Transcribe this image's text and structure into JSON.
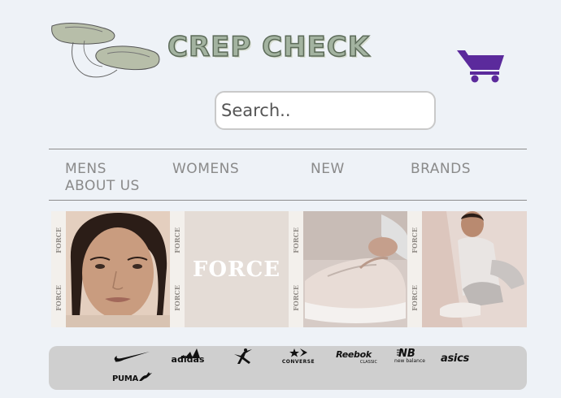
{
  "header": {
    "title": "CREP CHECK",
    "logo_icon": "sneakers-sketch-icon",
    "cart_icon": "shopping-cart-icon",
    "accent_color": "#5b2a9c"
  },
  "search": {
    "placeholder": "Search.."
  },
  "nav": {
    "items": [
      {
        "label": "MENS"
      },
      {
        "label": "WOMENS"
      },
      {
        "label": "NEW"
      },
      {
        "label": "BRANDS"
      },
      {
        "label": "ABOUT US"
      }
    ]
  },
  "hero": {
    "strip_text": "FORCE",
    "panels": [
      {
        "type": "portrait-photo"
      },
      {
        "type": "logo-panel",
        "text": "FORCE"
      },
      {
        "type": "sneaker-photo"
      },
      {
        "type": "model-photo"
      }
    ]
  },
  "brands": {
    "items": [
      {
        "label": "nike",
        "icon": "nike-swoosh-icon"
      },
      {
        "label": "adidas",
        "icon": "adidas-stripes-icon"
      },
      {
        "label": "jordan",
        "icon": "jumpman-icon"
      },
      {
        "label": "CONVERSE",
        "icon": "converse-star-icon"
      },
      {
        "label": "Reebok",
        "sublabel": "CLASSIC"
      },
      {
        "label": "new balance",
        "icon": "new-balance-nb-icon"
      },
      {
        "label": "asics"
      },
      {
        "label": "PUMA",
        "icon": "puma-cat-icon"
      }
    ]
  }
}
